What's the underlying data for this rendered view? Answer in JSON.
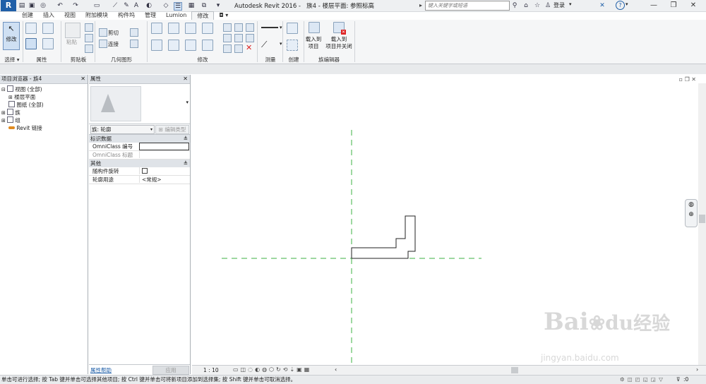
{
  "titlebar": {
    "app_title": "Autodesk Revit 2016 -",
    "doc_title": "族4 - 楼层平面: 参照标高",
    "search_placeholder": "键入关键字或短语",
    "login_label": "登录",
    "help_label": "?"
  },
  "tabs": [
    "创建",
    "插入",
    "视图",
    "附加模块",
    "构件坞",
    "管理",
    "Lumion",
    "修改"
  ],
  "active_tab": "修改",
  "ribbon": {
    "modify_label": "修改",
    "select_label": "选择 ▾",
    "properties_panel": "属性",
    "paste_label": "粘贴",
    "clipboard_panel": "剪贴板",
    "cut_label": "剪切",
    "join_label": "连接",
    "geometry_panel": "几何图形",
    "modify_panel": "修改",
    "measure_panel": "测量",
    "create_panel": "创建",
    "load_into_project": "载入到\n项目",
    "load_into_project_line1": "载入到",
    "load_into_project_line2": "项目",
    "load_close_line1": "载入到",
    "load_close_line2": "项目并关闭",
    "family_editor_panel": "族编辑器"
  },
  "browser": {
    "title": "项目浏览器 - 族4",
    "items": [
      {
        "label": "视图 (全部)",
        "indent": 0,
        "icon": "views-icon"
      },
      {
        "label": "楼层平面",
        "indent": 1,
        "icon": "plus-icon"
      },
      {
        "label": "图纸 (全部)",
        "indent": 0,
        "icon": "sheets-icon"
      },
      {
        "label": "族",
        "indent": 0,
        "icon": "families-icon"
      },
      {
        "label": "组",
        "indent": 0,
        "icon": "groups-icon"
      },
      {
        "label": "Revit 链接",
        "indent": 0,
        "icon": "links-icon"
      }
    ]
  },
  "properties": {
    "title": "属性",
    "type_selector": "族: 轮廓",
    "edit_type": "编辑类型",
    "group_identity": "标识数据",
    "omniclass_number": "OmniClass 编号",
    "omniclass_title": "OmniClass 标题",
    "group_other": "其他",
    "rotate_with_component": "随构件旋转",
    "profile_usage": "轮廓用途",
    "profile_usage_value": "<常规>",
    "help_link": "属性帮助",
    "apply_button": "应用"
  },
  "viewbar": {
    "scale": "1 : 10"
  },
  "status": {
    "text": "单击可进行选择; 按 Tab 键并单击可选择其他项目; 按 Ctrl 键并单击可将新项目添加到选择集; 按 Shift 键并单击可取消选择。",
    "filter_count": ":0"
  },
  "watermark": {
    "line1": "Bai",
    "line2": "经验",
    "url": "jingyan.baidu.com"
  },
  "colors": {
    "reference_line": "#3cb043",
    "profile_line": "#222222",
    "accent": "#1f5fa8"
  }
}
